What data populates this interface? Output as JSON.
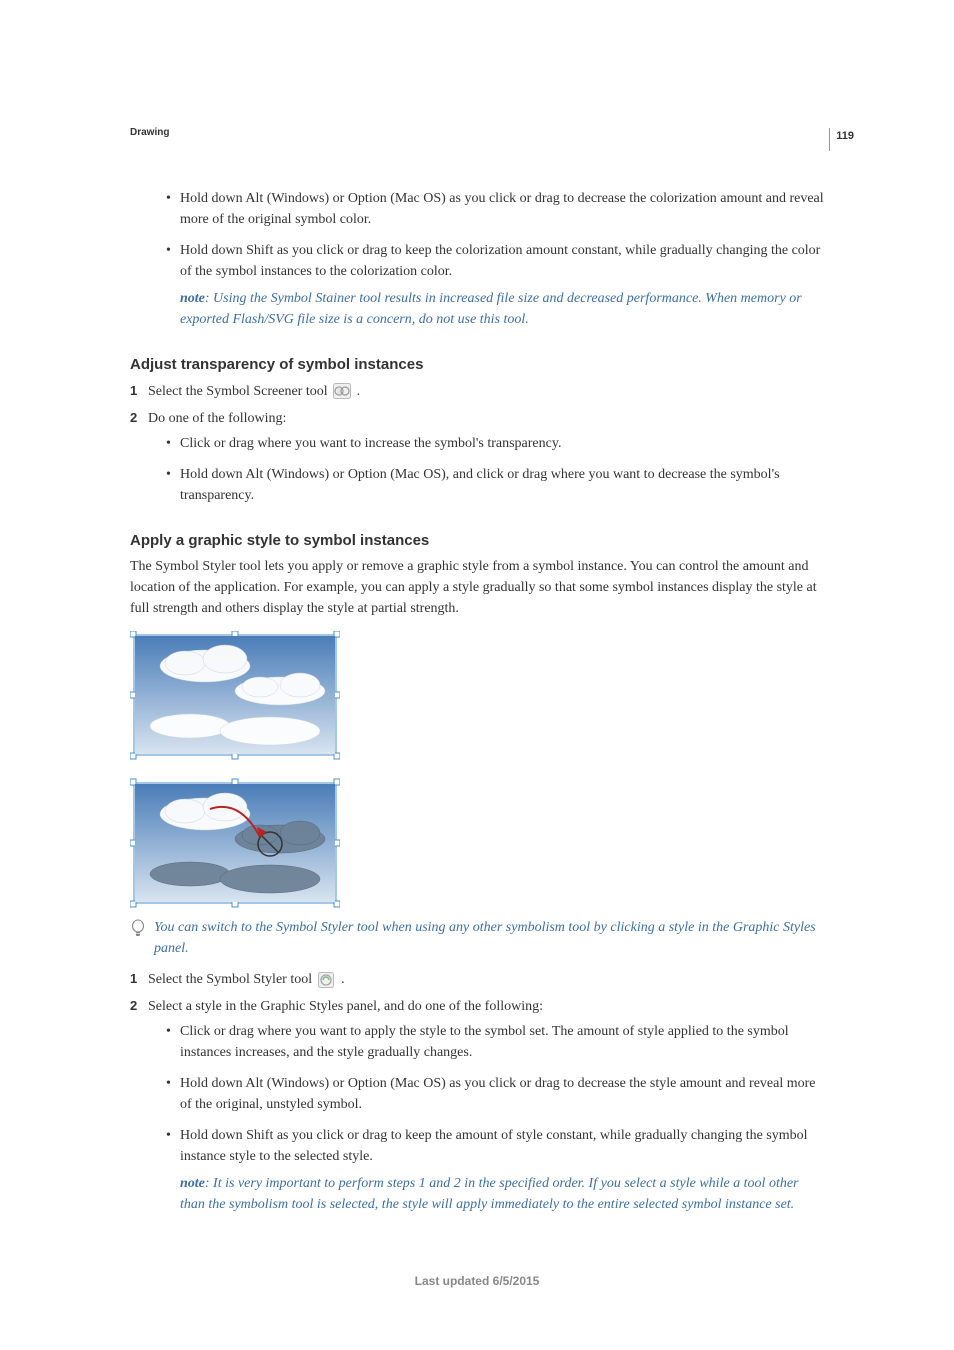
{
  "page_number": "119",
  "running_header": "Drawing",
  "section1": {
    "bullets": [
      "Hold down Alt (Windows) or Option (Mac OS) as you click or drag to decrease the colorization amount and reveal more of the original symbol color.",
      "Hold down Shift as you click or drag to keep the colorization amount constant, while gradually changing the color of the symbol instances to the colorization color."
    ],
    "note_label": "note",
    "note_text": ": Using the Symbol Stainer tool results in increased file size and decreased performance. When memory or exported Flash/SVG file size is a concern, do not use this tool."
  },
  "section2": {
    "heading": "Adjust transparency of symbol instances",
    "step1_num": "1",
    "step1_text_before": "Select the Symbol Screener tool ",
    "step1_text_after": " .",
    "step2_num": "2",
    "step2_text": "Do one of the following:",
    "step2_bullets": [
      "Click or drag where you want to increase the symbol's transparency.",
      "Hold down Alt (Windows) or Option (Mac OS), and click or drag where you want to decrease the symbol's transparency."
    ]
  },
  "section3": {
    "heading": "Apply a graphic style to symbol instances",
    "intro": "The Symbol Styler tool lets you apply or remove a graphic style from a symbol instance. You can control the amount and location of the application. For example, you can apply a style gradually so that some symbol instances display the style at full strength and others display the style at partial strength.",
    "tip": "You can switch to the Symbol Styler tool when using any other symbolism tool by clicking a style in the Graphic Styles panel.",
    "step1_num": "1",
    "step1_text_before": "Select the Symbol Styler tool ",
    "step1_text_after": " .",
    "step2_num": "2",
    "step2_text": "Select a style in the Graphic Styles panel, and do one of the following:",
    "step2_bullets": [
      "Click or drag where you want to apply the style to the symbol set. The amount of style applied to the symbol instances increases, and the style gradually changes.",
      "Hold down Alt (Windows) or Option (Mac OS) as you click or drag to decrease the style amount and reveal more of the original, unstyled symbol.",
      "Hold down Shift as you click or drag to keep the amount of style constant, while gradually changing the symbol instance style to the selected style."
    ],
    "note_label": "note",
    "note_text": ": It is very important to perform steps 1 and 2 in the specified order. If you select a style while a tool other than the symbolism tool is selected, the style will apply immediately to the entire selected symbol instance set."
  },
  "last_updated": "Last updated 6/5/2015"
}
